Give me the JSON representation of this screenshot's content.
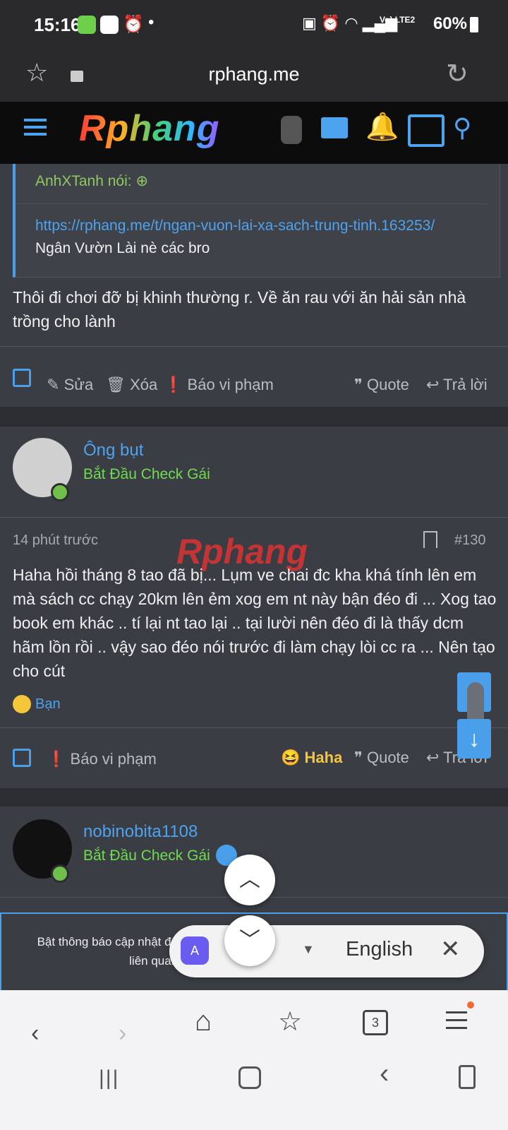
{
  "status": {
    "time": "15:16",
    "battery": "60%",
    "network": "Vo) LTE2"
  },
  "browser": {
    "url": "rphang.me"
  },
  "site": {
    "logo_text": "Rphang",
    "watermark": "Rphang"
  },
  "quote": {
    "author": "AnhXTanh nói:",
    "link": "https://rphang.me/t/ngan-vuon-lai-xa-sach-trung-tinh.163253/",
    "text": "Ngân Vườn Lài nè các bro"
  },
  "post1": {
    "body": "Thôi đi chơi đỡ bị khinh thường r. Về ăn rau với ăn hải sản nhà trồng cho lành",
    "actions": {
      "edit": "Sửa",
      "delete": "Xóa",
      "report": "Báo vi phạm",
      "quote": "Quote",
      "reply": "Trả lời"
    }
  },
  "post2": {
    "username": "Ông bụt",
    "user_title": "Bắt Đầu Check Gái",
    "time": "14 phút trước",
    "number": "#130",
    "body": "Haha hồi tháng 8 tao đã bị... Lụm ve chai đc kha khá tính lên em mà sách cc chạy 20km lên ẻm xog em nt này bận đéo đi ... Xog tao book em khác .. tí lại nt tao lại .. tại lười nên đéo đi là thấy dcm hãm lồn rồi .. vậy sao đéo nói trước đi làm chạy lòi cc ra ... Nên tạo cho cút",
    "reaction_by": "Bạn",
    "actions": {
      "report": "Báo vi phạm",
      "haha": "Haha",
      "quote": "Quote",
      "reply": "Trả lời"
    }
  },
  "post3": {
    "username": "nobinobita1108",
    "user_title": "Bắt Đầu Check Gái"
  },
  "notification": {
    "text": "Bật thông báo cập nhật để nhận thông báo về hoạt động diễn đàn và những gì liên quan tới bạn của bạn. Nhấn vào đây để"
  },
  "translate": {
    "language": "English"
  },
  "tabs_count": "3",
  "colors": {
    "accent": "#4a9fea",
    "green": "#6fdc4f",
    "bg": "#2b2d31"
  }
}
